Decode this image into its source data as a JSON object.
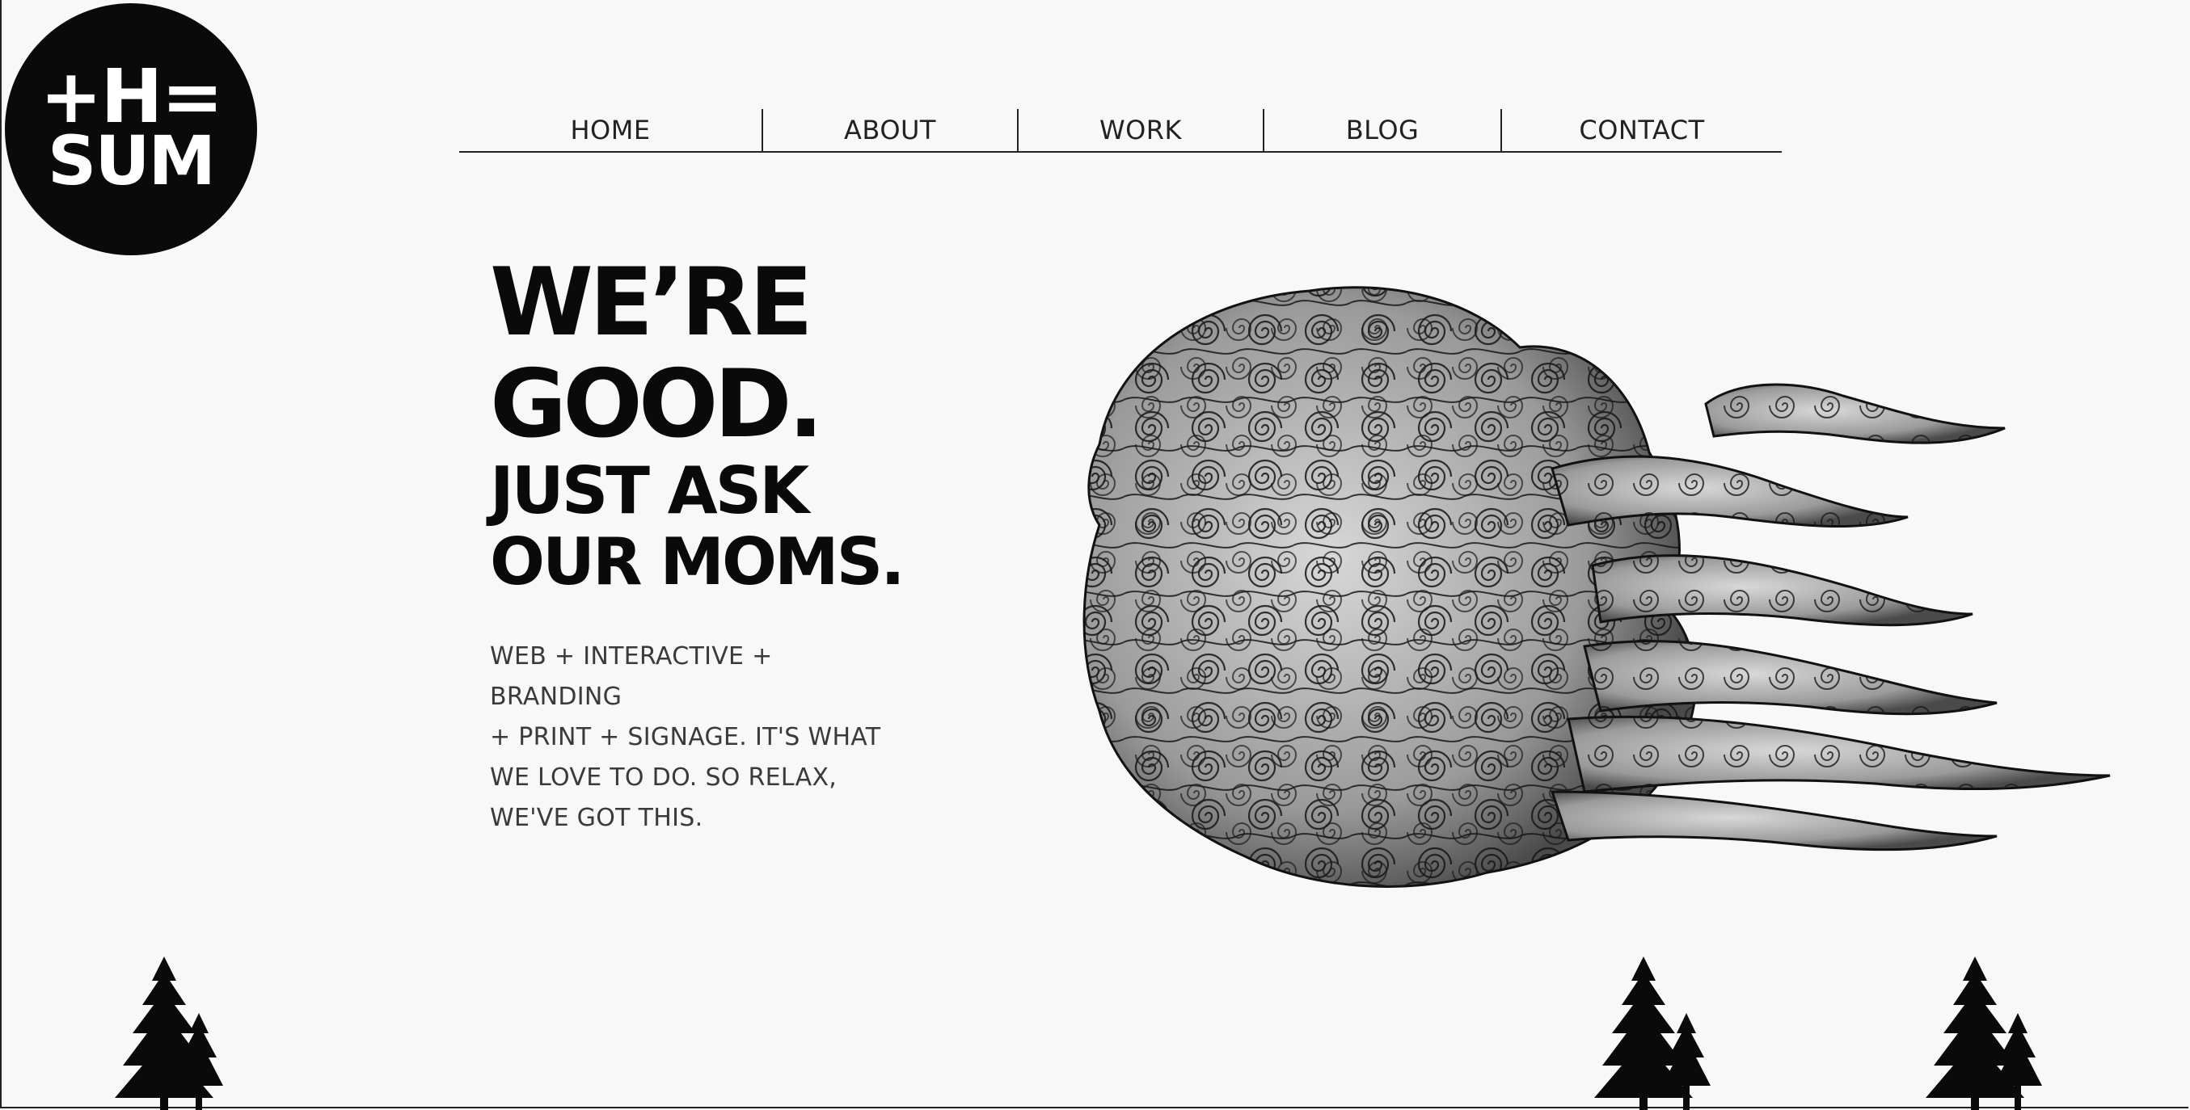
{
  "logo": {
    "line1": "+H=",
    "line2": "SUM"
  },
  "nav": {
    "items": [
      {
        "label": "HOME"
      },
      {
        "label": "ABOUT"
      },
      {
        "label": "WORK"
      },
      {
        "label": "BLOG"
      },
      {
        "label": "CONTACT"
      }
    ]
  },
  "hero": {
    "headline_line1": "WE’RE",
    "headline_line2": "GOOD.",
    "headline_line3": "JUST ASK",
    "headline_line4": "OUR MOMS.",
    "tagline_lines": [
      "WEB + INTERACTIVE + BRANDING",
      "+ PRINT + SIGNAGE. IT'S WHAT",
      "WE LOVE TO DO. SO RELAX,",
      "WE'VE GOT THIS."
    ]
  },
  "colors": {
    "background": "#f8f8f8",
    "ink": "#0a0a0a",
    "text": "#3a3a3a"
  },
  "icons": {
    "illustration": "swirl-cloud-illustration",
    "tree": "pine-tree-icon"
  }
}
